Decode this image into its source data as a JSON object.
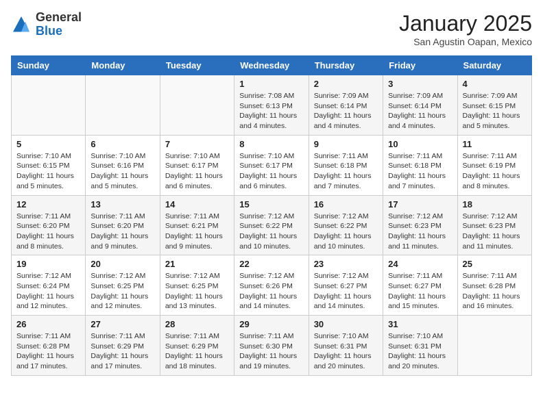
{
  "header": {
    "logo_general": "General",
    "logo_blue": "Blue",
    "month_title": "January 2025",
    "subtitle": "San Agustin Oapan, Mexico"
  },
  "weekdays": [
    "Sunday",
    "Monday",
    "Tuesday",
    "Wednesday",
    "Thursday",
    "Friday",
    "Saturday"
  ],
  "weeks": [
    [
      {
        "day": "",
        "info": ""
      },
      {
        "day": "",
        "info": ""
      },
      {
        "day": "",
        "info": ""
      },
      {
        "day": "1",
        "info": "Sunrise: 7:08 AM\nSunset: 6:13 PM\nDaylight: 11 hours and 4 minutes."
      },
      {
        "day": "2",
        "info": "Sunrise: 7:09 AM\nSunset: 6:14 PM\nDaylight: 11 hours and 4 minutes."
      },
      {
        "day": "3",
        "info": "Sunrise: 7:09 AM\nSunset: 6:14 PM\nDaylight: 11 hours and 4 minutes."
      },
      {
        "day": "4",
        "info": "Sunrise: 7:09 AM\nSunset: 6:15 PM\nDaylight: 11 hours and 5 minutes."
      }
    ],
    [
      {
        "day": "5",
        "info": "Sunrise: 7:10 AM\nSunset: 6:15 PM\nDaylight: 11 hours and 5 minutes."
      },
      {
        "day": "6",
        "info": "Sunrise: 7:10 AM\nSunset: 6:16 PM\nDaylight: 11 hours and 5 minutes."
      },
      {
        "day": "7",
        "info": "Sunrise: 7:10 AM\nSunset: 6:17 PM\nDaylight: 11 hours and 6 minutes."
      },
      {
        "day": "8",
        "info": "Sunrise: 7:10 AM\nSunset: 6:17 PM\nDaylight: 11 hours and 6 minutes."
      },
      {
        "day": "9",
        "info": "Sunrise: 7:11 AM\nSunset: 6:18 PM\nDaylight: 11 hours and 7 minutes."
      },
      {
        "day": "10",
        "info": "Sunrise: 7:11 AM\nSunset: 6:18 PM\nDaylight: 11 hours and 7 minutes."
      },
      {
        "day": "11",
        "info": "Sunrise: 7:11 AM\nSunset: 6:19 PM\nDaylight: 11 hours and 8 minutes."
      }
    ],
    [
      {
        "day": "12",
        "info": "Sunrise: 7:11 AM\nSunset: 6:20 PM\nDaylight: 11 hours and 8 minutes."
      },
      {
        "day": "13",
        "info": "Sunrise: 7:11 AM\nSunset: 6:20 PM\nDaylight: 11 hours and 9 minutes."
      },
      {
        "day": "14",
        "info": "Sunrise: 7:11 AM\nSunset: 6:21 PM\nDaylight: 11 hours and 9 minutes."
      },
      {
        "day": "15",
        "info": "Sunrise: 7:12 AM\nSunset: 6:22 PM\nDaylight: 11 hours and 10 minutes."
      },
      {
        "day": "16",
        "info": "Sunrise: 7:12 AM\nSunset: 6:22 PM\nDaylight: 11 hours and 10 minutes."
      },
      {
        "day": "17",
        "info": "Sunrise: 7:12 AM\nSunset: 6:23 PM\nDaylight: 11 hours and 11 minutes."
      },
      {
        "day": "18",
        "info": "Sunrise: 7:12 AM\nSunset: 6:23 PM\nDaylight: 11 hours and 11 minutes."
      }
    ],
    [
      {
        "day": "19",
        "info": "Sunrise: 7:12 AM\nSunset: 6:24 PM\nDaylight: 11 hours and 12 minutes."
      },
      {
        "day": "20",
        "info": "Sunrise: 7:12 AM\nSunset: 6:25 PM\nDaylight: 11 hours and 12 minutes."
      },
      {
        "day": "21",
        "info": "Sunrise: 7:12 AM\nSunset: 6:25 PM\nDaylight: 11 hours and 13 minutes."
      },
      {
        "day": "22",
        "info": "Sunrise: 7:12 AM\nSunset: 6:26 PM\nDaylight: 11 hours and 14 minutes."
      },
      {
        "day": "23",
        "info": "Sunrise: 7:12 AM\nSunset: 6:27 PM\nDaylight: 11 hours and 14 minutes."
      },
      {
        "day": "24",
        "info": "Sunrise: 7:11 AM\nSunset: 6:27 PM\nDaylight: 11 hours and 15 minutes."
      },
      {
        "day": "25",
        "info": "Sunrise: 7:11 AM\nSunset: 6:28 PM\nDaylight: 11 hours and 16 minutes."
      }
    ],
    [
      {
        "day": "26",
        "info": "Sunrise: 7:11 AM\nSunset: 6:28 PM\nDaylight: 11 hours and 17 minutes."
      },
      {
        "day": "27",
        "info": "Sunrise: 7:11 AM\nSunset: 6:29 PM\nDaylight: 11 hours and 17 minutes."
      },
      {
        "day": "28",
        "info": "Sunrise: 7:11 AM\nSunset: 6:29 PM\nDaylight: 11 hours and 18 minutes."
      },
      {
        "day": "29",
        "info": "Sunrise: 7:11 AM\nSunset: 6:30 PM\nDaylight: 11 hours and 19 minutes."
      },
      {
        "day": "30",
        "info": "Sunrise: 7:10 AM\nSunset: 6:31 PM\nDaylight: 11 hours and 20 minutes."
      },
      {
        "day": "31",
        "info": "Sunrise: 7:10 AM\nSunset: 6:31 PM\nDaylight: 11 hours and 20 minutes."
      },
      {
        "day": "",
        "info": ""
      }
    ]
  ]
}
